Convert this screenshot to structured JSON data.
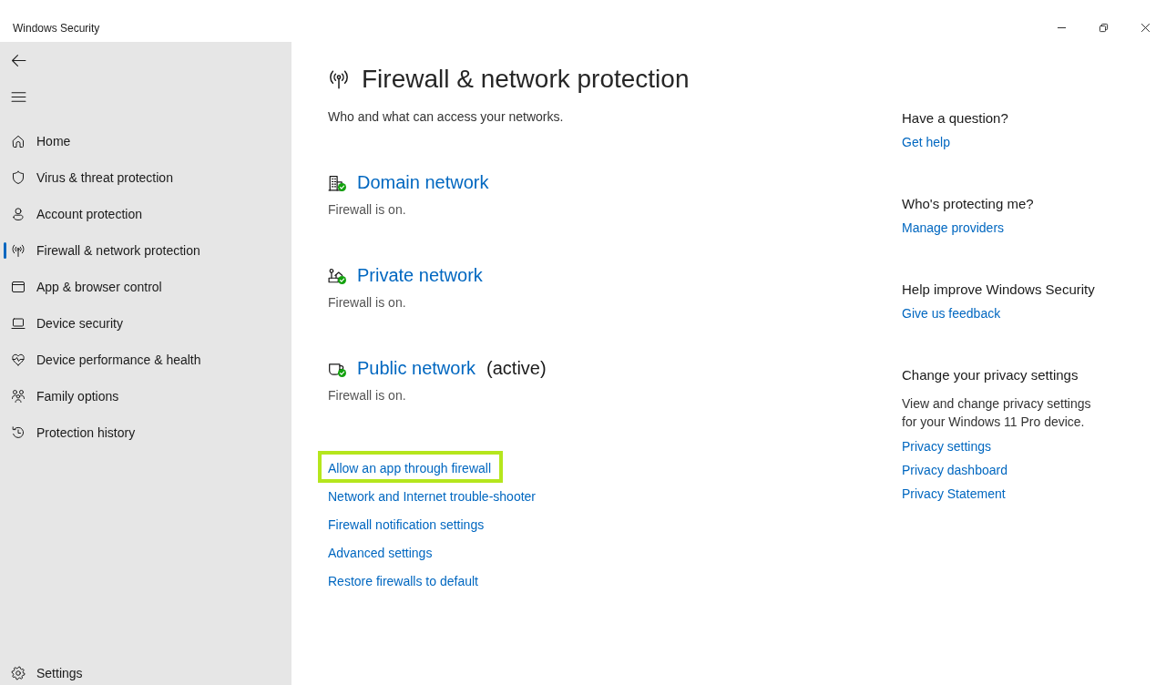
{
  "window": {
    "title": "Windows Security"
  },
  "sidebar": {
    "items": [
      {
        "label": "Home",
        "selected": false
      },
      {
        "label": "Virus & threat protection",
        "selected": false
      },
      {
        "label": "Account protection",
        "selected": false
      },
      {
        "label": "Firewall & network protection",
        "selected": true
      },
      {
        "label": "App & browser control",
        "selected": false
      },
      {
        "label": "Device security",
        "selected": false
      },
      {
        "label": "Device performance & health",
        "selected": false
      },
      {
        "label": "Family options",
        "selected": false
      },
      {
        "label": "Protection history",
        "selected": false
      }
    ],
    "footer_item": {
      "label": "Settings"
    }
  },
  "page": {
    "title": "Firewall & network protection",
    "subtitle": "Who and what can access your networks."
  },
  "networks": [
    {
      "title": "Domain network",
      "status": "Firewall is on.",
      "on": true
    },
    {
      "title": "Private network",
      "status": "Firewall is on.",
      "on": true
    },
    {
      "title": "Public network",
      "note": "(active)",
      "status": "Firewall is on.",
      "on": true
    }
  ],
  "links": [
    {
      "label": "Allow an app through firewall",
      "highlighted": true
    },
    {
      "label": "Network and Internet trouble-shooter",
      "highlighted": false
    },
    {
      "label": "Firewall notification settings",
      "highlighted": false
    },
    {
      "label": "Advanced settings",
      "highlighted": false
    },
    {
      "label": "Restore firewalls to default",
      "highlighted": false
    }
  ],
  "help_sections": [
    {
      "heading": "Have a question?",
      "links": [
        "Get help"
      ]
    },
    {
      "heading": "Who's protecting me?",
      "links": [
        "Manage providers"
      ]
    },
    {
      "heading": "Help improve Windows Security",
      "links": [
        "Give us feedback"
      ]
    },
    {
      "heading": "Change your privacy settings",
      "text": "View and change privacy settings for your Windows 11 Pro device.",
      "links": [
        "Privacy settings",
        "Privacy dashboard",
        "Privacy Statement"
      ]
    }
  ]
}
